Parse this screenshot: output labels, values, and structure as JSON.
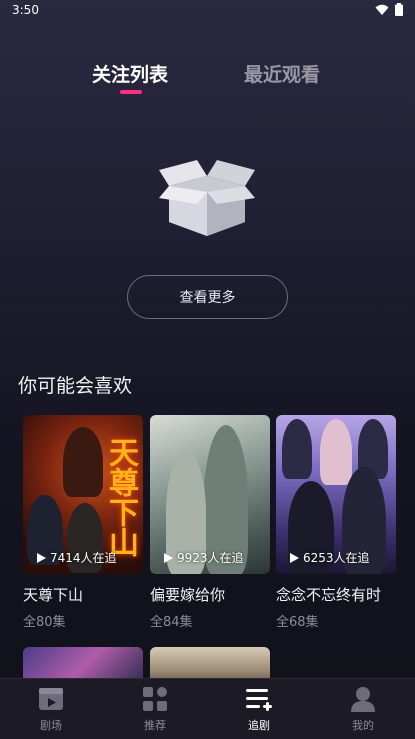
{
  "status_bar": {
    "time": "3:50"
  },
  "tabs": {
    "following": "关注列表",
    "recent": "最近观看"
  },
  "empty_state": {
    "more_button": "查看更多"
  },
  "recommend": {
    "title": "你可能会喜欢",
    "items": [
      {
        "title": "天尊下山",
        "episodes": "全80集",
        "watching": "7414人在追",
        "poster_text": "天尊下山"
      },
      {
        "title": "偏要嫁给你",
        "episodes": "全84集",
        "watching": "9923人在追"
      },
      {
        "title": "念念不忘终有时",
        "episodes": "全68集",
        "watching": "6253人在追"
      }
    ]
  },
  "tabbar": {
    "items": [
      {
        "label": "剧场",
        "icon": "theater-icon"
      },
      {
        "label": "推荐",
        "icon": "grid-icon"
      },
      {
        "label": "追剧",
        "icon": "playlist-add-icon"
      },
      {
        "label": "我的",
        "icon": "profile-icon"
      }
    ],
    "active": "追剧"
  },
  "colors": {
    "accent": "#ff2e7e",
    "background": "#1a1928"
  }
}
